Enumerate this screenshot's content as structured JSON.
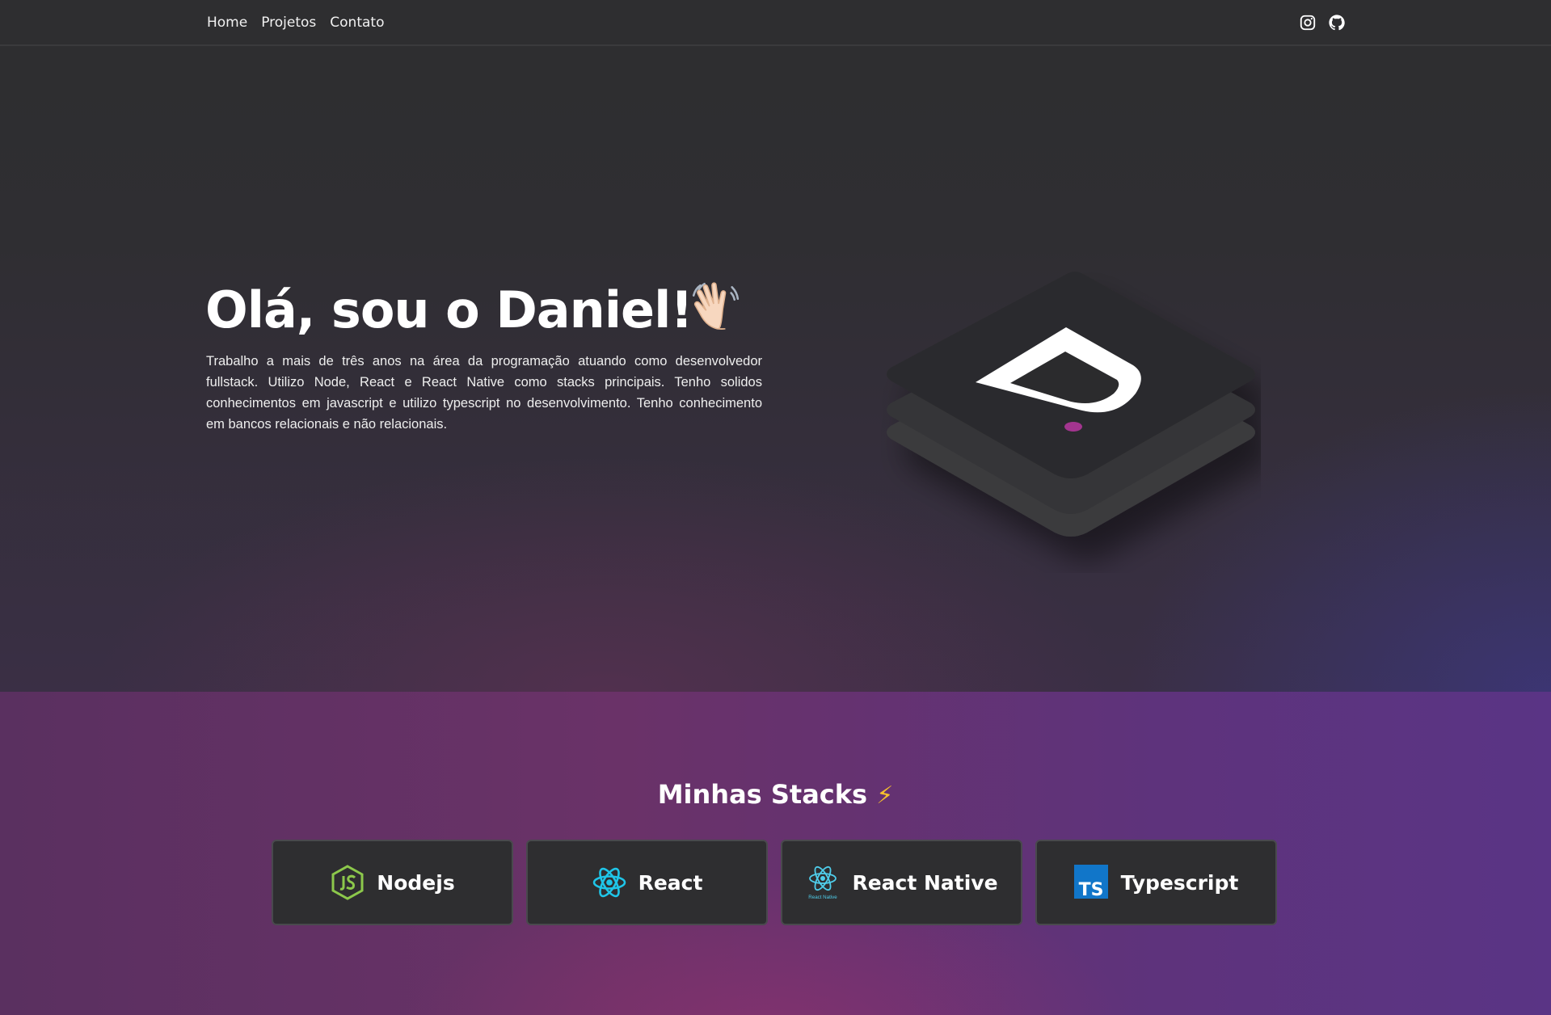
{
  "nav": {
    "links": [
      "Home",
      "Projetos",
      "Contato"
    ],
    "icons": [
      "instagram-icon",
      "github-icon"
    ]
  },
  "hero": {
    "title": "Olá, sou o Daniel!",
    "emoji_icon": "waving-hand-icon",
    "description": "Trabalho a mais de três anos na área da programação atuando como desenvolvedor fullstack. Utilizo Node, React e React Native como stacks principais. Tenho solidos conhecimentos em javascript e utilizo typescript no desenvolvimento. Tenho conhecimento em bancos relacionais e não relacionais.",
    "logo_icon": "d-logo-icon"
  },
  "stacks": {
    "title": "Minhas Stacks",
    "title_icon": "lightning-icon",
    "items": [
      {
        "label": "Nodejs",
        "icon": "nodejs-icon"
      },
      {
        "label": "React",
        "icon": "react-icon"
      },
      {
        "label": "React Native",
        "icon": "react-native-icon",
        "icon_caption": "React Native"
      },
      {
        "label": "Typescript",
        "icon": "typescript-icon",
        "icon_caption": "TS"
      }
    ]
  },
  "colors": {
    "background": "#2e2e30",
    "accent_pink": "#a3358f",
    "node_green": "#8cc84b",
    "react_cyan": "#1fc5e8",
    "ts_blue": "#1176c9"
  }
}
